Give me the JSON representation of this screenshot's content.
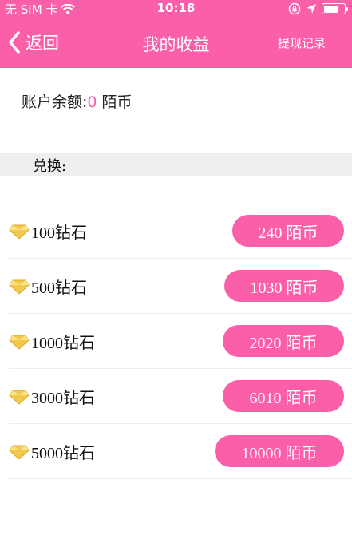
{
  "status_bar": {
    "carrier": "无 SIM 卡",
    "time": "10:18"
  },
  "nav": {
    "back_label": "返回",
    "title": "我的收益",
    "right_action": "提现记录"
  },
  "balance": {
    "label": "账户余额:",
    "value": "0",
    "unit": " 陌币"
  },
  "exchange": {
    "label": "兑换:"
  },
  "items": [
    {
      "diamonds": "100钻石",
      "price": "240 陌币"
    },
    {
      "diamonds": "500钻石",
      "price": "1030 陌币"
    },
    {
      "diamonds": "1000钻石",
      "price": "2020 陌币"
    },
    {
      "diamonds": "3000钻石",
      "price": "6010 陌币"
    },
    {
      "diamonds": "5000钻石",
      "price": "10000 陌币"
    }
  ],
  "colors": {
    "accent": "#fb5fa9",
    "section_bg": "#eeeeee",
    "diamond": "#f2c94c"
  }
}
